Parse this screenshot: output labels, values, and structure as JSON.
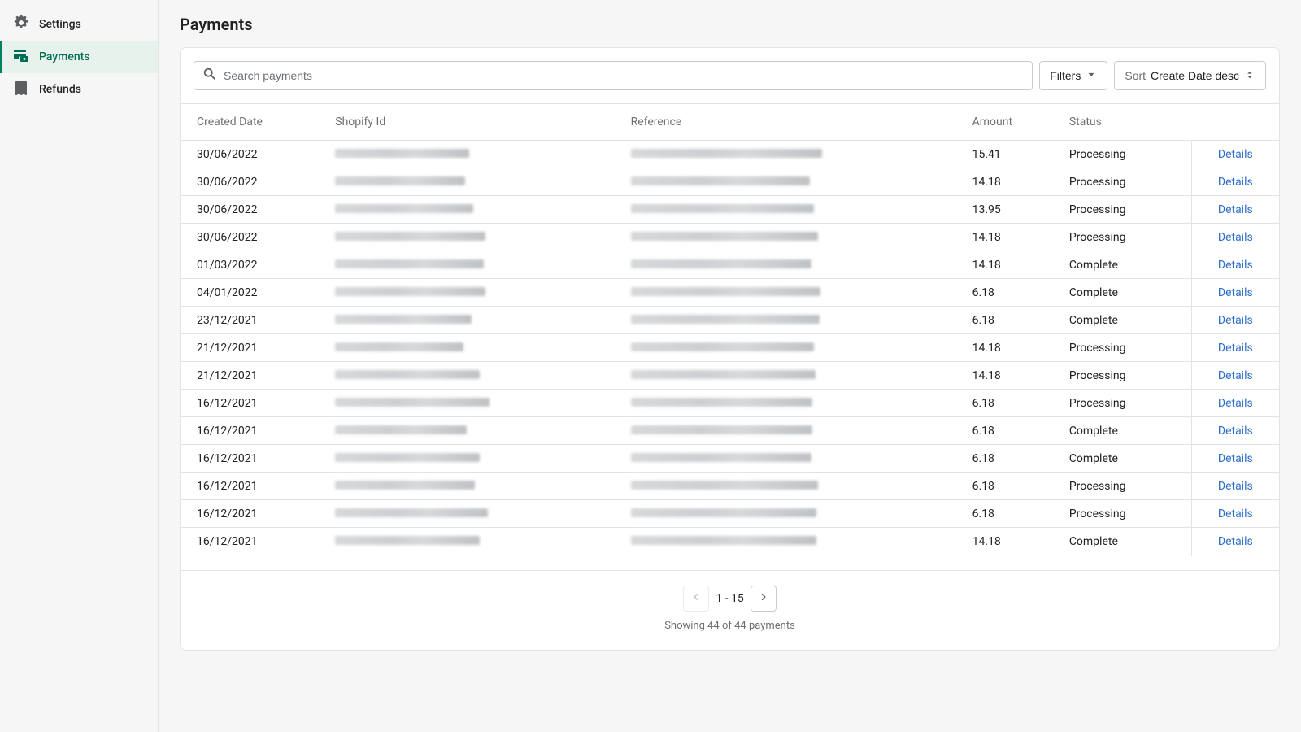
{
  "sidebar": {
    "items": [
      {
        "label": "Settings",
        "icon": "gear",
        "active": false
      },
      {
        "label": "Payments",
        "icon": "payments",
        "active": true
      },
      {
        "label": "Refunds",
        "icon": "refunds",
        "active": false
      }
    ]
  },
  "page": {
    "title": "Payments"
  },
  "toolbar": {
    "search_placeholder": "Search payments",
    "filters_label": "Filters",
    "sort_prefix": "Sort",
    "sort_value": "Create Date desc"
  },
  "table": {
    "headers": {
      "created": "Created Date",
      "shopify": "Shopify Id",
      "reference": "Reference",
      "amount": "Amount",
      "status": "Status"
    },
    "details_label": "Details",
    "rows": [
      {
        "created": "30/06/2022",
        "amount": "15.41",
        "status": "Processing",
        "shopify_w": 165,
        "reference_w": 235
      },
      {
        "created": "30/06/2022",
        "amount": "14.18",
        "status": "Processing",
        "shopify_w": 160,
        "reference_w": 220
      },
      {
        "created": "30/06/2022",
        "amount": "13.95",
        "status": "Processing",
        "shopify_w": 170,
        "reference_w": 225
      },
      {
        "created": "30/06/2022",
        "amount": "14.18",
        "status": "Processing",
        "shopify_w": 185,
        "reference_w": 230
      },
      {
        "created": "01/03/2022",
        "amount": "14.18",
        "status": "Complete",
        "shopify_w": 183,
        "reference_w": 222
      },
      {
        "created": "04/01/2022",
        "amount": "6.18",
        "status": "Complete",
        "shopify_w": 185,
        "reference_w": 233
      },
      {
        "created": "23/12/2021",
        "amount": "6.18",
        "status": "Complete",
        "shopify_w": 168,
        "reference_w": 232
      },
      {
        "created": "21/12/2021",
        "amount": "14.18",
        "status": "Processing",
        "shopify_w": 158,
        "reference_w": 225
      },
      {
        "created": "21/12/2021",
        "amount": "14.18",
        "status": "Processing",
        "shopify_w": 178,
        "reference_w": 227
      },
      {
        "created": "16/12/2021",
        "amount": "6.18",
        "status": "Processing",
        "shopify_w": 190,
        "reference_w": 223
      },
      {
        "created": "16/12/2021",
        "amount": "6.18",
        "status": "Complete",
        "shopify_w": 162,
        "reference_w": 223
      },
      {
        "created": "16/12/2021",
        "amount": "6.18",
        "status": "Complete",
        "shopify_w": 178,
        "reference_w": 222
      },
      {
        "created": "16/12/2021",
        "amount": "6.18",
        "status": "Processing",
        "shopify_w": 172,
        "reference_w": 230
      },
      {
        "created": "16/12/2021",
        "amount": "6.18",
        "status": "Processing",
        "shopify_w": 188,
        "reference_w": 228
      },
      {
        "created": "16/12/2021",
        "amount": "14.18",
        "status": "Complete",
        "shopify_w": 178,
        "reference_w": 228
      }
    ]
  },
  "pagination": {
    "range": "1 - 15",
    "showing": "Showing 44 of 44 payments"
  }
}
